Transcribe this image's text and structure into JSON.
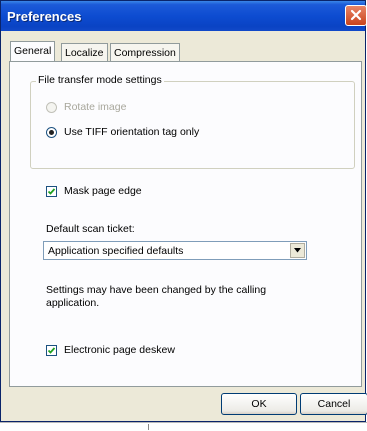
{
  "window": {
    "title": "Preferences"
  },
  "tabs": [
    {
      "label": "General",
      "active": true
    },
    {
      "label": "Localize",
      "active": false
    },
    {
      "label": "Compression",
      "active": false
    }
  ],
  "file_transfer_group": {
    "legend": "File transfer mode settings",
    "options": [
      {
        "label": "Rotate image",
        "selected": false,
        "disabled": true
      },
      {
        "label": "Use TIFF orientation tag only",
        "selected": true,
        "disabled": false
      }
    ]
  },
  "mask_page_edge": {
    "label": "Mask page edge",
    "checked": true
  },
  "scan_ticket": {
    "label": "Default scan ticket:",
    "selected_value": "Application specified defaults"
  },
  "note": {
    "line1": "Settings may have been changed by the calling",
    "line2": "application."
  },
  "deskew": {
    "label": "Electronic page deskew",
    "checked": true
  },
  "buttons": {
    "ok": "OK",
    "cancel": "Cancel"
  },
  "icons": {
    "close": "close-icon",
    "dropdown": "chevron-down-icon",
    "check": "checkmark-icon"
  }
}
